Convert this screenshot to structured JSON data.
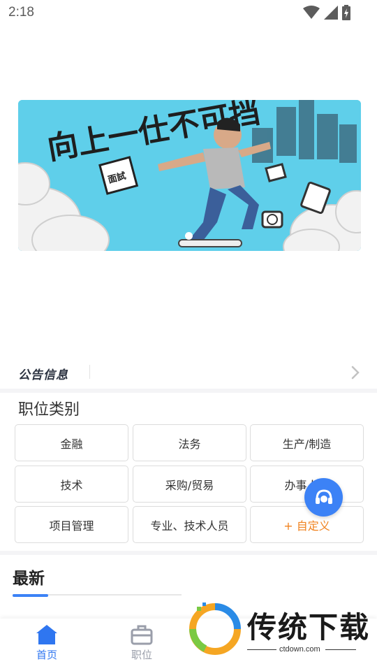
{
  "status_bar": {
    "time": "2:18",
    "icons": [
      "wifi-icon",
      "signal-icon",
      "battery-charging-icon"
    ]
  },
  "banner": {
    "calligraphy": "向上一仕不可挡",
    "book_label": "面試",
    "colors": {
      "background": "#5fcfea",
      "ink": "#1e1e1e"
    }
  },
  "notice": {
    "logo_text": "公告信息"
  },
  "categories": {
    "title": "职位类别",
    "items": [
      {
        "label": "金融"
      },
      {
        "label": "法务"
      },
      {
        "label": "生产/制造"
      },
      {
        "label": "技术"
      },
      {
        "label": "采购/贸易"
      },
      {
        "label": "办事人员"
      },
      {
        "label": "项目管理"
      },
      {
        "label": "专业、技术人员"
      },
      {
        "label": "+ 自定义"
      }
    ]
  },
  "latest": {
    "title": "最新"
  },
  "tabbar": {
    "home": {
      "label": "首页",
      "icon": "home-icon"
    },
    "jobs": {
      "label": "职位",
      "icon": "briefcase-icon"
    }
  },
  "watermark": {
    "text": "传统下载",
    "url": "ctdown.com"
  },
  "colors": {
    "accent": "#3c82f6",
    "custom_orange": "#f0821e",
    "tab_active": "#2f76f0",
    "tab_inactive": "#9a9eaa"
  }
}
